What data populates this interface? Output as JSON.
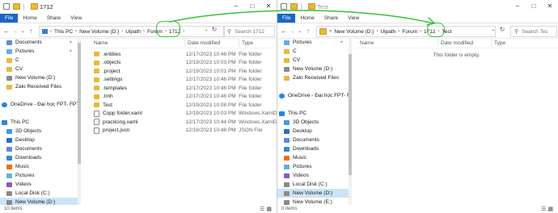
{
  "left": {
    "title": "1712",
    "ribbon_tabs": [
      "File",
      "Home",
      "Share",
      "View"
    ],
    "breadcrumb": [
      "This PC",
      "New Volume (D:)",
      "Uipath",
      "Forum",
      "1712"
    ],
    "search_placeholder": "Search 1712",
    "columns": [
      "Name",
      "Date modified",
      "Type"
    ],
    "files": [
      {
        "name": ".entities",
        "date": "12/17/2023 10:46 PM",
        "type": "File folder",
        "icon": "folder-icon"
      },
      {
        "name": ".objects",
        "date": "12/19/2023 10:03 PM",
        "type": "File folder",
        "icon": "folder-icon"
      },
      {
        "name": ".project",
        "date": "12/19/2023 10:01 PM",
        "type": "File folder",
        "icon": "folder-icon"
      },
      {
        "name": ".settings",
        "date": "12/17/2023 10:46 PM",
        "type": "File folder",
        "icon": "folder-icon"
      },
      {
        "name": ".templates",
        "date": "12/17/2023 10:46 PM",
        "type": "File folder",
        "icon": "folder-icon"
      },
      {
        "name": ".tmh",
        "date": "12/17/2023 10:46 PM",
        "type": "File folder",
        "icon": "folder-icon"
      },
      {
        "name": "Test",
        "date": "12/19/2023 10:08 PM",
        "type": "File folder",
        "icon": "folder-icon"
      },
      {
        "name": "Copp folder.xaml",
        "date": "12/19/2023 10:03 PM",
        "type": "Windows.XamlDo...",
        "icon": "file-icon"
      },
      {
        "name": "practicing.xaml",
        "date": "12/17/2023 10:44 PM",
        "type": "Windows.XamlDo...",
        "icon": "file-icon"
      },
      {
        "name": "project.json",
        "date": "12/19/2023 10:46 PM",
        "type": "JSON File",
        "icon": "file-icon"
      }
    ],
    "status": "10 items",
    "nav": [
      {
        "label": "Documents",
        "icon": "doc",
        "pin": true,
        "indent": 8
      },
      {
        "label": "Pictures",
        "icon": "pic",
        "pin": true,
        "indent": 8
      },
      {
        "label": "C",
        "icon": "folder",
        "pin": false,
        "indent": 8
      },
      {
        "label": "CV",
        "icon": "folder",
        "pin": false,
        "indent": 8
      },
      {
        "label": "New Volume (D:)",
        "icon": "drive",
        "pin": false,
        "indent": 8
      },
      {
        "label": "Zalo Received Files",
        "icon": "folder",
        "pin": false,
        "indent": 8
      },
      {
        "label": "",
        "icon": "",
        "pin": false,
        "indent": 0
      },
      {
        "label": "OneDrive - Đại học FPT- FPT U",
        "icon": "cloud",
        "pin": false,
        "indent": 2
      },
      {
        "label": "",
        "icon": "",
        "pin": false,
        "indent": 0
      },
      {
        "label": "This PC",
        "icon": "pc",
        "pin": false,
        "indent": 2
      },
      {
        "label": "3D Objects",
        "icon": "3d",
        "pin": false,
        "indent": 8
      },
      {
        "label": "Desktop",
        "icon": "desk",
        "pin": false,
        "indent": 8
      },
      {
        "label": "Documents",
        "icon": "doc",
        "pin": false,
        "indent": 8
      },
      {
        "label": "Downloads",
        "icon": "dl",
        "pin": false,
        "indent": 8
      },
      {
        "label": "Music",
        "icon": "music",
        "pin": false,
        "indent": 8
      },
      {
        "label": "Pictures",
        "icon": "pic",
        "pin": false,
        "indent": 8
      },
      {
        "label": "Videos",
        "icon": "vid",
        "pin": false,
        "indent": 8
      },
      {
        "label": "Local Disk (C:)",
        "icon": "drive",
        "pin": false,
        "indent": 8
      },
      {
        "label": "New Volume (D:)",
        "icon": "drive",
        "pin": false,
        "indent": 8,
        "selected": true
      },
      {
        "label": "New Volume (E:)",
        "icon": "drive",
        "pin": false,
        "indent": 8
      }
    ]
  },
  "right": {
    "title": "Test",
    "ribbon_tabs": [
      "File",
      "Home",
      "Share",
      "View"
    ],
    "breadcrumb": [
      "New Volume (D:)",
      "Uipath",
      "Forum",
      "1712",
      "Test"
    ],
    "search_placeholder": "Search Tes",
    "columns": [
      "Name",
      "Date modified",
      "Type"
    ],
    "empty_text": "This folder is empty.",
    "status": "0 items",
    "nav": [
      {
        "label": "Pictures",
        "icon": "pic",
        "pin": true,
        "indent": 8
      },
      {
        "label": "C",
        "icon": "folder",
        "pin": false,
        "indent": 8
      },
      {
        "label": "CV",
        "icon": "folder",
        "pin": false,
        "indent": 8
      },
      {
        "label": "New Volume (D:)",
        "icon": "drive",
        "pin": false,
        "indent": 8
      },
      {
        "label": "Zalo Received Files",
        "icon": "folder",
        "pin": false,
        "indent": 8
      },
      {
        "label": "",
        "icon": "",
        "pin": false,
        "indent": 0
      },
      {
        "label": "OneDrive - Đại học FPT- FPT U",
        "icon": "cloud",
        "pin": false,
        "indent": 2
      },
      {
        "label": "",
        "icon": "",
        "pin": false,
        "indent": 0
      },
      {
        "label": "This PC",
        "icon": "pc",
        "pin": false,
        "indent": 2
      },
      {
        "label": "3D Objects",
        "icon": "3d",
        "pin": false,
        "indent": 8
      },
      {
        "label": "Desktop",
        "icon": "desk",
        "pin": false,
        "indent": 8
      },
      {
        "label": "Documents",
        "icon": "doc",
        "pin": false,
        "indent": 8
      },
      {
        "label": "Downloads",
        "icon": "dl",
        "pin": false,
        "indent": 8
      },
      {
        "label": "Music",
        "icon": "music",
        "pin": false,
        "indent": 8
      },
      {
        "label": "Pictures",
        "icon": "pic",
        "pin": false,
        "indent": 8
      },
      {
        "label": "Videos",
        "icon": "vid",
        "pin": false,
        "indent": 8
      },
      {
        "label": "Local Disk (C:)",
        "icon": "drive",
        "pin": false,
        "indent": 8
      },
      {
        "label": "New Volume (D:)",
        "icon": "drive",
        "pin": false,
        "indent": 8,
        "selected": true
      },
      {
        "label": "New Volume (E:)",
        "icon": "drive",
        "pin": false,
        "indent": 8
      }
    ]
  },
  "colors": {
    "accent": "#1a66c8",
    "selection": "#cce4f7",
    "annotation": "#35c435"
  }
}
